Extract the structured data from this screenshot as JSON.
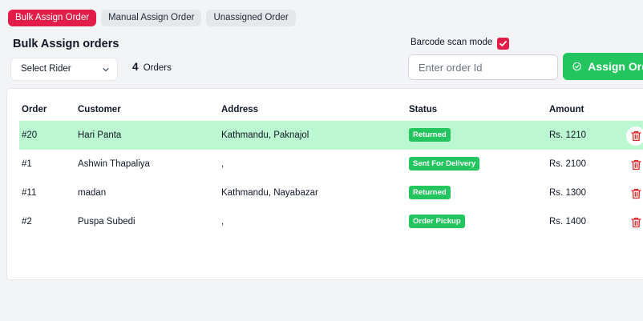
{
  "tabs": [
    {
      "label": "Bulk Assign Order",
      "active": true
    },
    {
      "label": "Manual Assign Order",
      "active": false
    },
    {
      "label": "Unassigned Order",
      "active": false
    }
  ],
  "page_title": "Bulk Assign orders",
  "rider_select": {
    "value": "Select Rider"
  },
  "orders_summary": {
    "count": "4",
    "label": "Orders"
  },
  "barcode": {
    "label": "Barcode scan mode",
    "checked": true
  },
  "order_input": {
    "placeholder": "Enter order Id",
    "value": ""
  },
  "assign_button": {
    "label": "Assign Order"
  },
  "table": {
    "headers": {
      "order": "Order",
      "customer": "Customer",
      "address": "Address",
      "status": "Status",
      "amount": "Amount"
    },
    "rows": [
      {
        "order": "#20",
        "customer": "Hari Panta",
        "address": "Kathmandu, Paknajol",
        "status": "Returned",
        "amount": "Rs. 1210",
        "highlighted": true
      },
      {
        "order": "#1",
        "customer": "Ashwin Thapaliya",
        "address": ",",
        "status": "Sent For Delivery",
        "amount": "Rs. 2100",
        "highlighted": false
      },
      {
        "order": "#11",
        "customer": "madan",
        "address": "Kathmandu, Nayabazar",
        "status": "Returned",
        "amount": "Rs. 1300",
        "highlighted": false
      },
      {
        "order": "#2",
        "customer": "Puspa Subedi",
        "address": ",",
        "status": "Order Pickup",
        "amount": "Rs. 1400",
        "highlighted": false
      }
    ]
  },
  "colors": {
    "accent": "#e11d48",
    "success": "#22c55e",
    "highlight_row": "#bbf7d0",
    "delete_icon": "#dc2626"
  },
  "icons": {
    "check": "check-icon",
    "chevron": "chevron-down-icon",
    "assign": "check-circle-icon",
    "delete": "trash-icon"
  }
}
